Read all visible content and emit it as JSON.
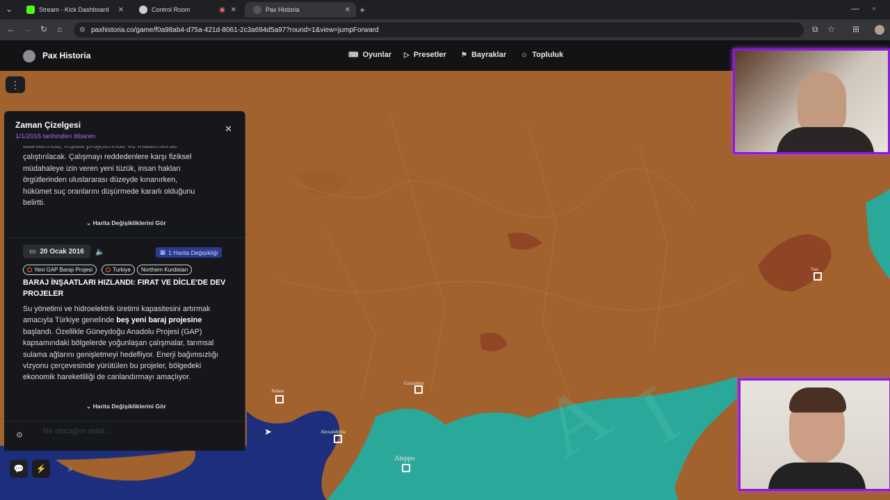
{
  "browser": {
    "tabs": [
      {
        "title": "Stream - Kick Dashboard",
        "icon": "kick-icon",
        "color": "#53fc18"
      },
      {
        "title": "Control Room",
        "icon": "globe-icon",
        "color": "#cfcfcf"
      },
      {
        "title": "Pax Historia",
        "icon": "globe-icon",
        "color": "#555"
      }
    ],
    "url": "paxhistoria.co/game/f0a98ab4-d75a-421d-8061-2c3a694d5a97?round=1&view=jumpForward"
  },
  "header": {
    "brand": "Pax Historia",
    "nav": [
      "Oyunlar",
      "Presetler",
      "Bayraklar",
      "Topluluk"
    ]
  },
  "timeline": {
    "title": "Zaman Çizelgesi",
    "subtitle": "1/1/2016 tarihinden itibaren",
    "prev_entry_lines": [
      "alanlarında, inşaat projelerinde ve madenlerde",
      "çalıştırılacak. Çalışmayı reddedenlere karşı fiziksel",
      "müdahaleye izin veren yeni tüzük, insan hakları",
      "örgütlerinden uluslararası düzeyde kınanırken,",
      "hükümet suç oranlarını düşürmede kararlı olduğunu",
      "belirtti."
    ],
    "map_changes_label": "Harita Değişikliklerini Gör",
    "entry": {
      "date": "20 Ocak 2016",
      "badge": "1 Harita Değişikliği",
      "tags": [
        "Yeni GAP Barajı Projesi",
        "Turkiye",
        "Northern Kurdistan"
      ],
      "headline": "BARAJ İNŞAATLARI HIZLANDI: FIRAT VE DİCLE'DE DEV PROJELER",
      "body_pre": "Su yönetimi ve hidroelektrik üretimi kapasitesini artırmak amacıyla Türkiye genelinde ",
      "body_bold": "beş yeni baraj projesine",
      "body_post": " başlandı. Özellikle Güneydoğu Anadolu Projesi (GAP) kapsamındaki bölgelerde yoğunlaşan çalışmalar, tarımsal sulama ağlarını genişletmeyi hedefliyor. Enerji bağımsızlığı vizyonu çerçevesinde yürütülen bu projeler, bölgedeki ekonomik hareketliliği de canlandırmayı amaçlıyor."
    },
    "footer_placeholder": "Ne olacağını anlat..."
  },
  "map": {
    "cities": [
      "Adana",
      "Gaziantep",
      "Alexandretta",
      "Aleppo",
      "Van"
    ],
    "colors": {
      "turkey": "#a2622d",
      "syria": "#2aa89a",
      "sea": "#1d2f7c"
    }
  }
}
